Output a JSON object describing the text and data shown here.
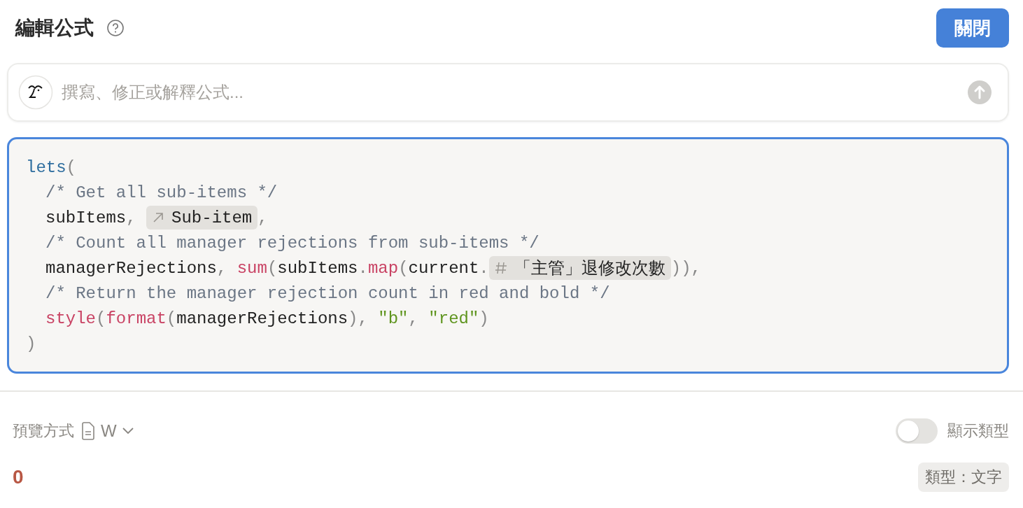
{
  "header": {
    "title": "編輯公式",
    "close_button": "關閉"
  },
  "ai_input": {
    "placeholder": "撰寫、修正或解釋公式..."
  },
  "editor": {
    "focused": true,
    "open": [
      {
        "kind": "keyword",
        "text": "lets"
      },
      {
        "kind": "punct",
        "text": "("
      }
    ],
    "body": [
      [
        {
          "kind": "comment",
          "text": "/* Get all sub-items */"
        }
      ],
      [
        {
          "kind": "plain",
          "text": "subItems"
        },
        {
          "kind": "punct",
          "text": ", "
        },
        {
          "kind": "relation_chip",
          "text": "Sub-item"
        },
        {
          "kind": "punct",
          "text": ","
        }
      ],
      [
        {
          "kind": "comment",
          "text": "/* Count all manager rejections from sub-items */"
        }
      ],
      [
        {
          "kind": "plain",
          "text": "managerRejections"
        },
        {
          "kind": "punct",
          "text": ", "
        },
        {
          "kind": "func",
          "text": "sum"
        },
        {
          "kind": "punct",
          "text": "("
        },
        {
          "kind": "plain",
          "text": "subItems"
        },
        {
          "kind": "punct",
          "text": "."
        },
        {
          "kind": "func",
          "text": "map"
        },
        {
          "kind": "punct",
          "text": "("
        },
        {
          "kind": "plain",
          "text": "current"
        },
        {
          "kind": "punct",
          "text": "."
        },
        {
          "kind": "number_chip",
          "text": "「主管」退修改次數"
        },
        {
          "kind": "punct",
          "text": ")),"
        }
      ],
      [
        {
          "kind": "comment",
          "text": "/* Return the manager rejection count in red and bold */"
        }
      ],
      [
        {
          "kind": "func",
          "text": "style"
        },
        {
          "kind": "punct",
          "text": "("
        },
        {
          "kind": "func",
          "text": "format"
        },
        {
          "kind": "punct",
          "text": "("
        },
        {
          "kind": "plain",
          "text": "managerRejections"
        },
        {
          "kind": "punct",
          "text": "), "
        },
        {
          "kind": "string",
          "text": "\"b\""
        },
        {
          "kind": "punct",
          "text": ", "
        },
        {
          "kind": "string",
          "text": "\"red\""
        },
        {
          "kind": "punct",
          "text": ")"
        }
      ]
    ],
    "close": [
      {
        "kind": "punct",
        "text": ")"
      }
    ]
  },
  "preview": {
    "label": "預覽方式",
    "format": "W",
    "show_type": {
      "label": "顯示類型",
      "on": false
    },
    "result": "0",
    "type_badge": "類型：文字"
  }
}
